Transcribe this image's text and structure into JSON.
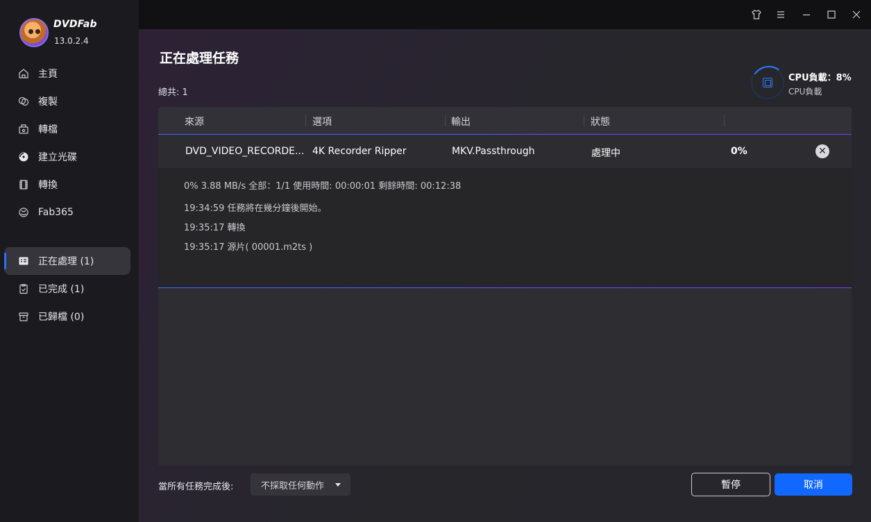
{
  "app": {
    "brand": "DVDFab",
    "version": "13.0.2.4"
  },
  "sidebar": {
    "items": [
      {
        "label": "主頁",
        "icon": "home-icon"
      },
      {
        "label": "複製",
        "icon": "copy-icon"
      },
      {
        "label": "轉檔",
        "icon": "ripper-icon"
      },
      {
        "label": "建立光碟",
        "icon": "disc-icon"
      },
      {
        "label": "轉換",
        "icon": "film-icon"
      },
      {
        "label": "Fab365",
        "icon": "fab365-icon"
      }
    ],
    "queue": [
      {
        "label": "正在處理 (1)",
        "icon": "processing-icon",
        "active": true
      },
      {
        "label": "已完成 (1)",
        "icon": "finished-icon"
      },
      {
        "label": "已歸檔 (0)",
        "icon": "archive-icon"
      }
    ]
  },
  "titlebar": {
    "buttons": [
      "shirt-skin-icon",
      "menu-icon",
      "minimize-icon",
      "maximize-icon",
      "close-icon"
    ]
  },
  "main": {
    "title": "正在處理任務",
    "total": "總共: 1",
    "cpu": {
      "title": "CPU負載：8%",
      "subtitle": "CPU負載",
      "percent": 8
    }
  },
  "table": {
    "headers": [
      "來源",
      "選項",
      "輸出",
      "狀態"
    ],
    "rows": [
      {
        "source": "DVD_VIDEO_RECORDE...",
        "option": "4K Recorder Ripper",
        "output": "MKV.Passthrough",
        "status": "處理中",
        "progress": "0%"
      }
    ],
    "detail": {
      "stats": "0%  3.88 MB/s   全部：1/1  使用時間:  00:00:01  剩餘時間:  00:12:38",
      "logs": [
        "19:34:59  任務將在幾分鐘後開始。",
        "19:35:17  轉換",
        "19:35:17  源片( 00001.m2ts )"
      ]
    }
  },
  "footer": {
    "after_label": "當所有任務完成後:",
    "after_value": "不採取任何動作",
    "pause": "暫停",
    "cancel": "取消"
  }
}
